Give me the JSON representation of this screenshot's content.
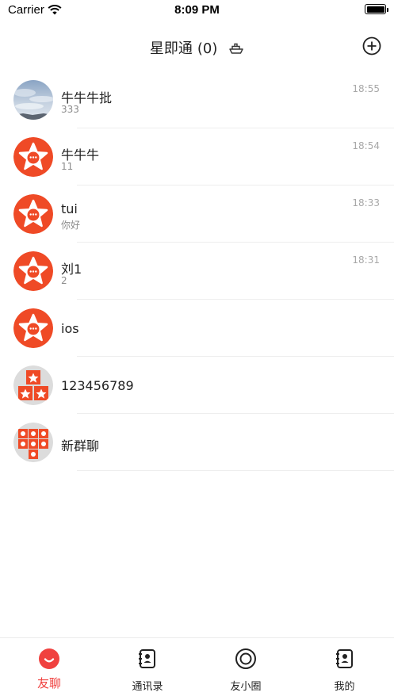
{
  "status_bar": {
    "carrier": "Carrier",
    "time": "8:09 PM"
  },
  "header": {
    "title": "星即通",
    "count": "(0)"
  },
  "chats": [
    {
      "name": "牛牛牛批",
      "subtitle": "333",
      "time": "18:55",
      "avatar": "sky-photo"
    },
    {
      "name": "牛牛牛",
      "subtitle": "11",
      "time": "18:54",
      "avatar": "star-logo"
    },
    {
      "name": "tui",
      "subtitle": "你好",
      "time": "18:33",
      "avatar": "star-logo"
    },
    {
      "name": "刘1",
      "subtitle": "2",
      "time": "18:31",
      "avatar": "star-logo"
    },
    {
      "name": "ios",
      "avatar": "star-logo"
    },
    {
      "name": "123456789",
      "avatar": "group-3"
    },
    {
      "name": "新群聊",
      "avatar": "group-7"
    }
  ],
  "tabs": [
    {
      "label": "友聊",
      "icon": "chat-bubble-icon",
      "active": true
    },
    {
      "label": "通讯录",
      "icon": "contacts-icon"
    },
    {
      "label": "友小圈",
      "icon": "moments-icon"
    },
    {
      "label": "我的",
      "icon": "profile-icon"
    }
  ],
  "colors": {
    "accent": "#f0413f",
    "brand": "#ef4a26"
  }
}
